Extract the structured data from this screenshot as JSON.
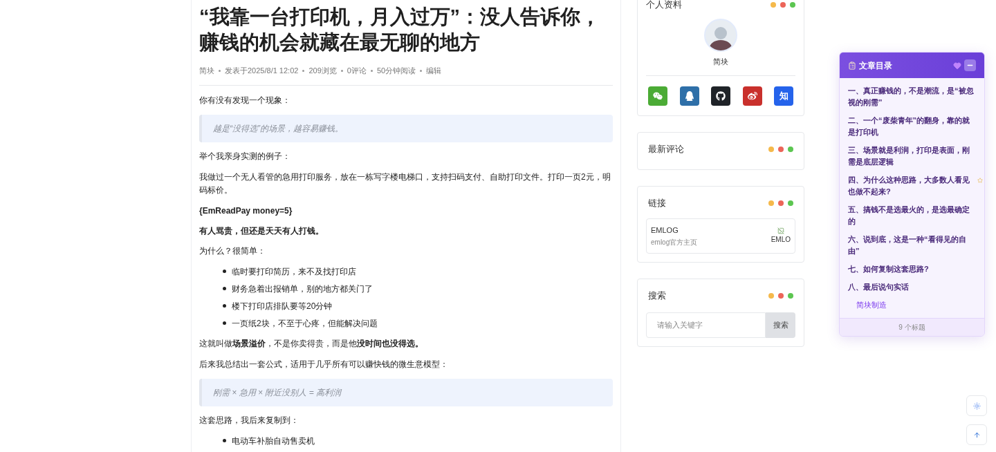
{
  "article": {
    "title": "“我靠一台打印机，月入过万”：没人告诉你，赚钱的机会就藏在最无聊的地方",
    "meta": [
      "简块",
      "发表于2025/8/1 12:02",
      "209浏览",
      "0评论",
      "50分钟阅读",
      "编辑"
    ],
    "blocks": [
      {
        "kind": "paragraph",
        "text": "你有没有发现一个现象："
      },
      {
        "kind": "quote",
        "text": "越是“没得选”的场景，越容易赚钱。"
      },
      {
        "kind": "paragraph",
        "text": "举个我亲身实测的例子："
      },
      {
        "kind": "paragraph",
        "text": "我做过一个无人看管的急用打印服务，放在一栋写字楼电梯口，支持扫码支付、自助打印文件。打印一页2元，明码标价。"
      },
      {
        "kind": "strong",
        "text": "{EmReadPay money=5}"
      },
      {
        "kind": "strong",
        "text": "有人骂贵，但还是天天有人打钱。"
      },
      {
        "kind": "paragraph",
        "text": "为什么？很简单："
      },
      {
        "kind": "list",
        "items": [
          "临时要打印简历，来不及找打印店",
          "财务急着出报销单，别的地方都关门了",
          "楼下打印店排队要等20分钟",
          "一页纸2块，不至于心疼，但能解决问题"
        ]
      },
      {
        "kind": "paragraph",
        "text": "这就叫做**场景溢价**，不是你卖得贵，而是他**没时间也没得选。**"
      },
      {
        "kind": "paragraph",
        "text": "后来我总结出一套公式，适用于几乎所有可以赚快钱的微生意模型："
      },
      {
        "kind": "quote",
        "text": "刚需 × 急用 × 附近没别人 = 高利润"
      },
      {
        "kind": "paragraph",
        "text": "这套思路，我后来复制到："
      },
      {
        "kind": "list",
        "items": [
          "电动车补胎自动售卖机"
        ]
      }
    ]
  },
  "sidebar": {
    "profile": {
      "title": "个人资料",
      "name": "简块",
      "socials": [
        {
          "kind": "wechat",
          "color": "#4bab35"
        },
        {
          "kind": "qq",
          "color": "#2e6fa8"
        },
        {
          "kind": "github",
          "color": "#1f2328"
        },
        {
          "kind": "weibo",
          "color": "#c9302c"
        },
        {
          "kind": "text",
          "label": "知",
          "color": "#2563eb"
        }
      ]
    },
    "comments": {
      "title": "最新评论"
    },
    "links": {
      "title": "链接",
      "items": [
        {
          "name": "EMLOG",
          "description": "emlog官方主页",
          "image_alt": "EMLO"
        }
      ]
    },
    "search": {
      "title": "搜索",
      "placeholder": "请输入关键字",
      "button": "搜索"
    }
  },
  "toc": {
    "title": "文章目录",
    "items": [
      {
        "text": "一、真正赚钱的，不是潮流，是“被忽视的刚需”"
      },
      {
        "text": "二、一个“废柴青年”的翻身，靠的就是打印机"
      },
      {
        "text": "三、场景就是利润，打印是表面，刚需是底层逻辑"
      },
      {
        "text": "四、为什么这种思路，大多数人看见也做不起来?"
      },
      {
        "text": "五、搞钱不是选最火的，是选最确定的"
      },
      {
        "text": "六、说到底，这是一种“看得见的自由”"
      },
      {
        "text": "七、如何复制这套思路?"
      },
      {
        "text": "八、最后说句实话",
        "children": [
          {
            "text": "简块制造"
          }
        ]
      }
    ],
    "footer": "9 个标题"
  }
}
